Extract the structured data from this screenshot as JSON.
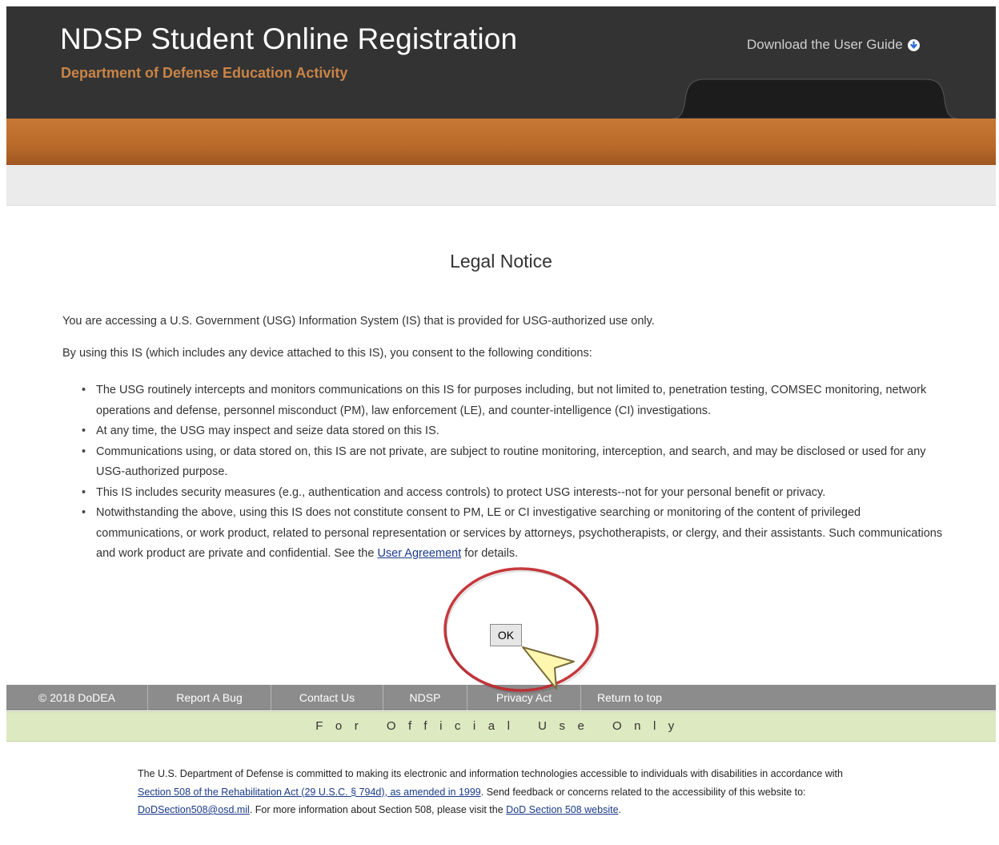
{
  "header": {
    "title": "NDSP Student Online Registration",
    "subtitle": "Department of Defense Education Activity",
    "guide_link": "Download the User Guide",
    "guide_icon": "download-arrow-icon"
  },
  "notice": {
    "title": "Legal Notice",
    "intro": "You are accessing a U.S. Government (USG) Information System (IS) that is provided for USG-authorized use only.",
    "consent": "By using this IS (which includes any device attached to this IS), you consent to the following conditions:",
    "bullets": [
      "The USG routinely intercepts and monitors communications on this IS for purposes including, but not limited to, penetration testing, COMSEC monitoring, network operations and defense, personnel misconduct (PM), law enforcement (LE), and counter-intelligence (CI) investigations.",
      "At any time, the USG may inspect and seize data stored on this IS.",
      "Communications using, or data stored on, this IS are not private, are subject to routine monitoring, interception, and search, and may be disclosed or used for any USG-authorized purpose.",
      "This IS includes security measures (e.g., authentication and access controls) to protect USG interests--not for your personal benefit or privacy."
    ],
    "last_bullet_text": "Notwithstanding the above, using this IS does not constitute consent to PM, LE or CI investigative searching or monitoring of the content of privileged communications, or work product, related to personal representation or services by attorneys, psychotherapists, or clergy, and their assistants. Such communications and work product are private and confidential. See the",
    "user_agreement_link": "User Agreement",
    "last_bullet_tail": "for details.",
    "ok_label": "OK"
  },
  "footer_nav": {
    "copyright": "© 2018 DoDEA",
    "report_bug": "Report A Bug",
    "contact": "Contact Us",
    "ndsp": "NDSP",
    "privacy": "Privacy Act",
    "return_top": "Return to top"
  },
  "fouo": "For Official Use Only",
  "accessibility": {
    "text1": "The U.S. Department of Defense is committed to making its electronic and information technologies accessible to individuals with disabilities in accordance with",
    "section508_link": "Section 508 of the Rehabilitation Act (29 U.S.C. § 794d), as amended in 1999",
    "text2": ". Send feedback or concerns related to the accessibility of this website to:",
    "email_link": "DoDSection508@osd.mil",
    "text3": ". For more information about Section 508, please visit the",
    "website_link": "DoD Section 508 website",
    "text4": "."
  },
  "colors": {
    "header_bg": "#333333",
    "subtitle": "#c98447",
    "orange_band": "#b96a2a",
    "footer_nav_bg": "#8c8c8c",
    "fouo_bg": "#dde9c0",
    "link": "#1a3a8a",
    "annotation_circle": "#c0282d",
    "cursor_fill": "#fff7b0"
  }
}
